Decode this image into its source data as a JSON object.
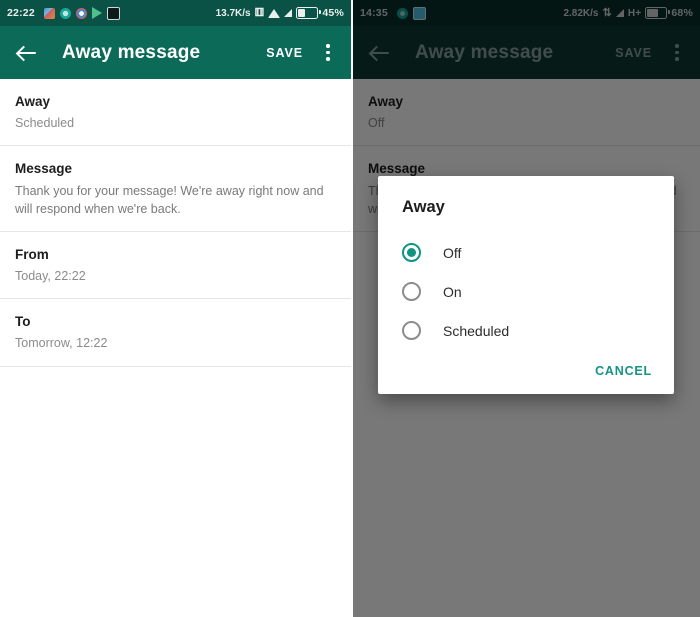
{
  "left_screen": {
    "status_bar": {
      "time": "22:22",
      "network_speed": "13.7K/s",
      "battery_percent": "45%",
      "icons": [
        "gallery-icon",
        "browser-icon",
        "chrome-icon",
        "play-store-icon",
        "card-icon",
        "sync-disabled-icon",
        "wifi-icon",
        "cellular-signal-icon",
        "battery-icon"
      ]
    },
    "app_bar": {
      "back_label": "back-arrow-icon",
      "title": "Away message",
      "save_label": "SAVE",
      "overflow_label": "overflow-menu-icon"
    },
    "rows": [
      {
        "title": "Away",
        "subtitle": "Scheduled"
      },
      {
        "title": "Message",
        "subtitle": "Thank you for your message! We're away right now and will respond when we're back."
      },
      {
        "title": "From",
        "subtitle": "Today, 22:22"
      },
      {
        "title": "To",
        "subtitle": "Tomorrow, 12:22"
      }
    ]
  },
  "right_screen": {
    "status_bar": {
      "time": "14:35",
      "network_speed": "2.82K/s",
      "network_type": "H+",
      "battery_percent": "68%",
      "icons": [
        "browser-icon",
        "picture-icon",
        "data-transfer-icon",
        "cellular-signal-icon",
        "battery-icon"
      ]
    },
    "app_bar": {
      "back_label": "back-arrow-icon",
      "title": "Away message",
      "save_label": "SAVE",
      "overflow_label": "overflow-menu-icon"
    },
    "rows": [
      {
        "title": "Away",
        "subtitle": "Off"
      },
      {
        "title": "Message",
        "subtitle": "Thank you for your message! We're away right now and will respond when we're back."
      }
    ],
    "dialog": {
      "title": "Away",
      "options": [
        {
          "label": "Off",
          "selected": true
        },
        {
          "label": "On",
          "selected": false
        },
        {
          "label": "Scheduled",
          "selected": false
        }
      ],
      "cancel_label": "CANCEL"
    }
  },
  "colors": {
    "app_bar_teal": "#0b6a58",
    "status_bar_teal": "#0a5245",
    "accent_teal": "#0f9582",
    "cancel_teal": "#149485",
    "scrim": "rgba(0,0,0,0.53)"
  }
}
